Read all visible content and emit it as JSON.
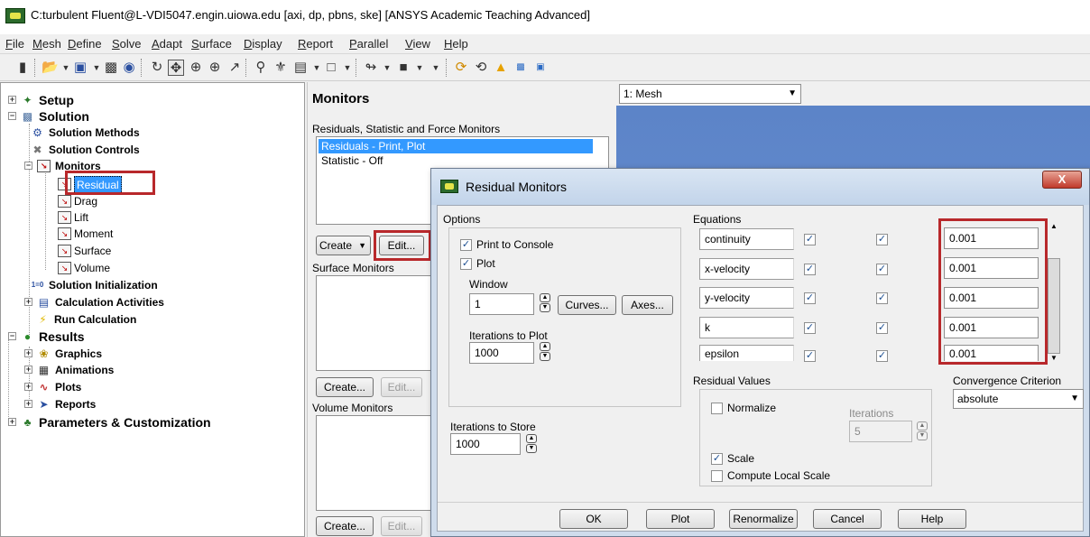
{
  "window": {
    "title": "C:turbulent Fluent@L-VDI5047.engin.uiowa.edu  [axi, dp, pbns, ske] [ANSYS Academic Teaching Advanced]"
  },
  "menu": [
    "File",
    "Mesh",
    "Define",
    "Solve",
    "Adapt",
    "Surface",
    "Display",
    "Report",
    "Parallel",
    "View",
    "Help"
  ],
  "tree": {
    "setup": "Setup",
    "solution": "Solution",
    "solution_methods": "Solution Methods",
    "solution_controls": "Solution Controls",
    "monitors": "Monitors",
    "residual": "Residual",
    "drag": "Drag",
    "lift": "Lift",
    "moment": "Moment",
    "surface": "Surface",
    "volume": "Volume",
    "solution_initialization": "Solution Initialization",
    "calculation_activities": "Calculation Activities",
    "run_calculation": "Run Calculation",
    "results": "Results",
    "graphics": "Graphics",
    "animations": "Animations",
    "plots": "Plots",
    "reports": "Reports",
    "parameters": "Parameters & Customization",
    "init_icon_text": "1=0"
  },
  "monitors_panel": {
    "title": "Monitors",
    "rsf_label": "Residuals, Statistic and Force Monitors",
    "rsf_items": [
      "Residuals - Print, Plot",
      "Statistic - Off"
    ],
    "create_label": "Create",
    "edit_label": "Edit...",
    "surface_label": "Surface Monitors",
    "surface_create": "Create...",
    "surface_edit": "Edit...",
    "volume_label": "Volume Monitors",
    "volume_create": "Create...",
    "volume_edit": "Edit..."
  },
  "graphics": {
    "window_select": "1: Mesh"
  },
  "dialog": {
    "title": "Residual Monitors",
    "close_label": "X",
    "options_label": "Options",
    "print_to_console": "Print to Console",
    "plot": "Plot",
    "window_label": "Window",
    "window_value": "1",
    "curves_label": "Curves...",
    "axes_label": "Axes...",
    "iterations_to_plot_label": "Iterations to Plot",
    "iterations_to_plot_value": "1000",
    "iterations_to_store_label": "Iterations to Store",
    "iterations_to_store_value": "1000",
    "equations_label": "Equations",
    "equations": [
      {
        "name": "continuity",
        "criterion": "0.001",
        "check_monitor": true,
        "check_converge": true
      },
      {
        "name": "x-velocity",
        "criterion": "0.001",
        "check_monitor": true,
        "check_converge": true
      },
      {
        "name": "y-velocity",
        "criterion": "0.001",
        "check_monitor": true,
        "check_converge": true
      },
      {
        "name": "k",
        "criterion": "0.001",
        "check_monitor": true,
        "check_converge": true
      },
      {
        "name": "epsilon",
        "criterion": "0.001",
        "check_monitor": true,
        "check_converge": true
      }
    ],
    "residual_values_label": "Residual Values",
    "normalize_label": "Normalize",
    "iterations_label": "Iterations",
    "iterations_value": "5",
    "scale_label": "Scale",
    "compute_local_scale_label": "Compute Local Scale",
    "convergence_label": "Convergence Criterion",
    "convergence_value": "absolute",
    "buttons": {
      "ok": "OK",
      "plot": "Plot",
      "renormalize": "Renormalize",
      "cancel": "Cancel",
      "help": "Help"
    }
  },
  "colors": {
    "highlight_box": "#b8282b",
    "selection": "#3399ff",
    "graphics_bg": "#6a8fd0"
  }
}
